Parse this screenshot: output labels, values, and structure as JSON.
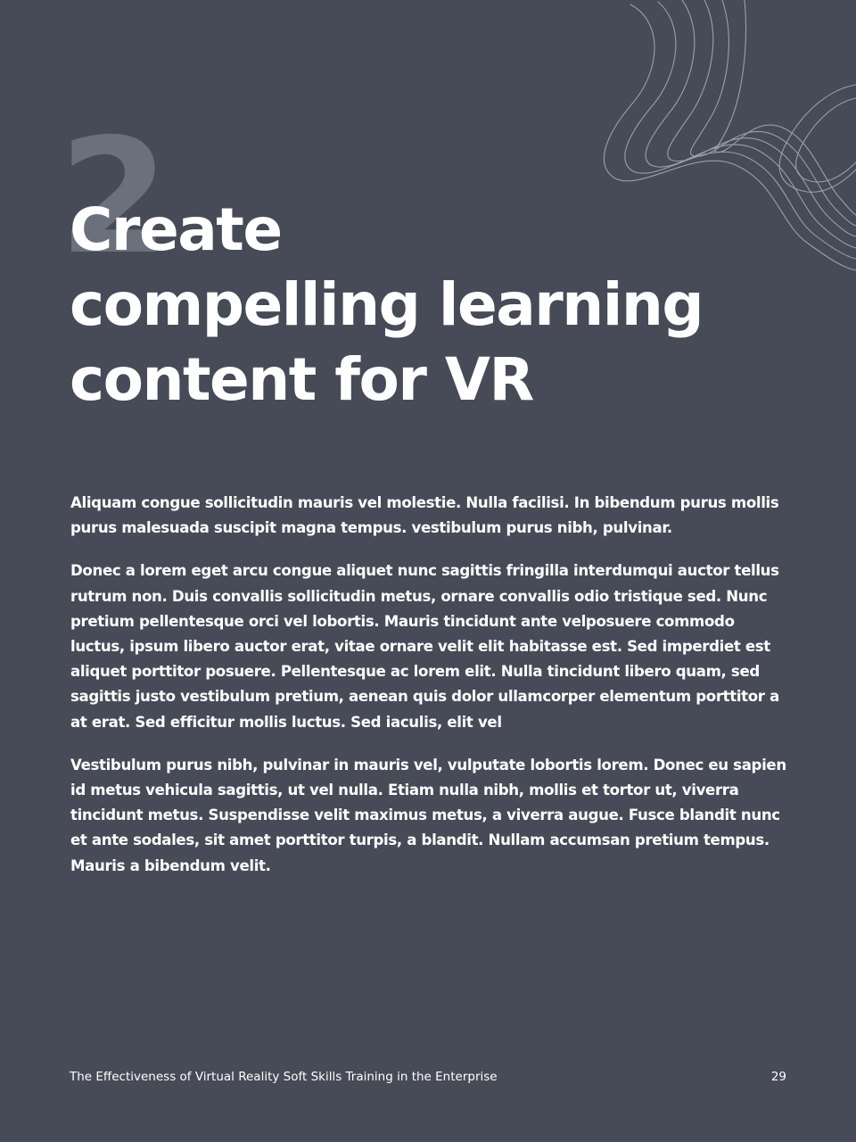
{
  "chapter": {
    "number": "2",
    "title_lines": [
      "Create",
      "compelling learning",
      "content for VR"
    ]
  },
  "body": {
    "paragraphs": [
      "Aliquam congue sollicitudin mauris vel molestie. Nulla facilisi. In bibendum purus mollis purus malesuada suscipit magna tempus. vestibulum purus nibh, pulvinar.",
      "Donec a lorem eget arcu congue aliquet nunc sagittis fringilla interdumqui auctor tellus rutrum non. Duis convallis sollicitudin metus, ornare convallis odio tristique sed. Nunc pretium pellentesque orci vel lobortis. Mauris tincidunt ante velposuere commodo luctus, ipsum libero auctor erat, vitae ornare velit elit habitasse est. Sed imperdiet est aliquet porttitor posuere. Pellentesque ac lorem elit. Nulla tincidunt libero quam, sed sagittis justo vestibulum pretium, aenean quis dolor ullamcorper elementum porttitor a at erat. Sed efficitur mollis luctus. Sed iaculis, elit vel",
      "Vestibulum purus nibh, pulvinar in mauris vel, vulputate lobortis lorem. Donec eu sapien id metus vehicula sagittis, ut vel nulla. Etiam nulla nibh, mollis et tortor ut, viverra tincidunt metus. Suspendisse velit maximus metus, a viverra augue. Fusce blandit nunc et ante sodales, sit amet porttitor turpis, a blandit. Nullam accumsan pretium tempus. Mauris a bibendum velit."
    ]
  },
  "footer": {
    "publication_title": "The Effectiveness of Virtual Reality Soft Skills Training in the Enterprise",
    "page_number": "29"
  },
  "colors": {
    "background": "#464b57",
    "text": "#ffffff",
    "chapter_number": "#6b717c",
    "decor_lines": "#9aa0aa"
  },
  "decor": {
    "icon": "wavy-lines-decoration"
  }
}
